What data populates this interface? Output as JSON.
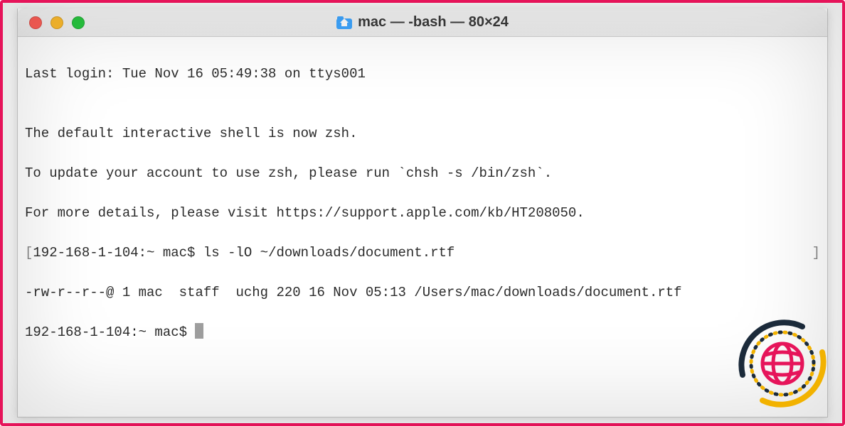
{
  "window": {
    "title": "mac — -bash — 80×24"
  },
  "terminal": {
    "lines": {
      "l0": "Last login: Tue Nov 16 05:49:38 on ttys001",
      "l1": "",
      "l2": "The default interactive shell is now zsh.",
      "l3": "To update your account to use zsh, please run `chsh -s /bin/zsh`.",
      "l4": "For more details, please visit https://support.apple.com/kb/HT208050.",
      "l5_open": "[",
      "l5_prompt": "192-168-1-104:~ mac$ ",
      "l5_cmd": "ls -lO ~/downloads/document.rtf",
      "l5_close": "]",
      "l6": "-rw-r--r--@ 1 mac  staff  uchg 220 16 Nov 05:13 /Users/mac/downloads/document.rtf",
      "l7_prompt": "192-168-1-104:~ mac$ "
    }
  }
}
